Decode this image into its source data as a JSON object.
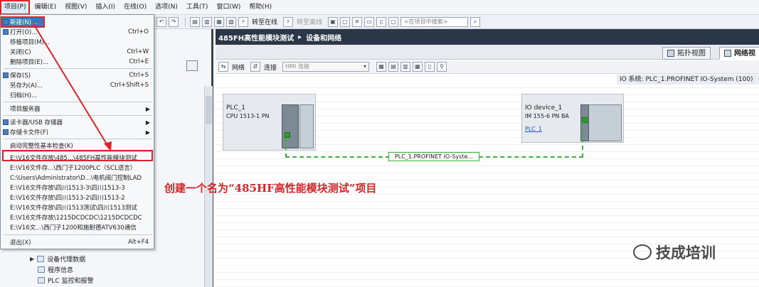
{
  "menubar": {
    "items": [
      "项目(P)",
      "编辑(E)",
      "视图(V)",
      "插入(I)",
      "在线(O)",
      "选项(N)",
      "工具(T)",
      "窗口(W)",
      "帮助(H)"
    ]
  },
  "toolbar": {
    "go_online": "转至在线",
    "go_offline": "转至离线",
    "search_placeholder": "<在项目中搜索>"
  },
  "project_menu": {
    "items": [
      {
        "label": "新建(N)...",
        "shortcut": ""
      },
      {
        "label": "打开(O)...",
        "shortcut": "Ctrl+O"
      },
      {
        "label": "移植项目(M)...",
        "shortcut": ""
      },
      {
        "label": "关闭(C)",
        "shortcut": "Ctrl+W"
      },
      {
        "label": "删除项目(E)...",
        "shortcut": "Ctrl+E"
      },
      {
        "label": "保存(S)",
        "shortcut": "Ctrl+S"
      },
      {
        "label": "另存为(A)...",
        "shortcut": "Ctrl+Shift+S"
      },
      {
        "label": "归档(H)...",
        "shortcut": ""
      },
      {
        "label": "项目服务器",
        "shortcut": ""
      },
      {
        "label": "读卡器/USB 存储器",
        "shortcut": ""
      },
      {
        "label": "存储卡文件(F)",
        "shortcut": ""
      },
      {
        "label": "启动完整性基本检查(K)",
        "shortcut": ""
      },
      {
        "label": "E:\\V16文件存放\\485...\\485FH高性能模块测试",
        "shortcut": ""
      },
      {
        "label": "E:\\V16文件存...\\西门子1200PLC（SCL语言）",
        "shortcut": ""
      },
      {
        "label": "C:\\Users\\Administrator\\D...\\电机阀门控制LAD",
        "shortcut": ""
      },
      {
        "label": "E:\\V16文件存放\\四川1513-3\\四川1513-3",
        "shortcut": ""
      },
      {
        "label": "E:\\V16文件存放\\四川1513-2\\四川1513-2",
        "shortcut": ""
      },
      {
        "label": "E:\\V16文件存放\\四川1513测试\\四川1513测试",
        "shortcut": ""
      },
      {
        "label": "E:\\V16文件存放\\1215DCDCDC\\1215DCDCDC",
        "shortcut": ""
      },
      {
        "label": "E:\\V16文...\\西门子1200和施耐德ATV630通信",
        "shortcut": ""
      },
      {
        "label": "退出(X)",
        "shortcut": "Alt+F4"
      }
    ]
  },
  "tree": {
    "items": [
      "设备代理数据",
      "程序信息",
      "PLC 监控和报警"
    ]
  },
  "editor": {
    "breadcrumb_project": "485FH高性能模块测试",
    "breadcrumb_view": "设备和网络",
    "tab_topology": "拓扑视图",
    "tab_network": "网络视",
    "btn_network": "网络",
    "btn_connection": "连接",
    "hmi_select": "HMI 连接",
    "io_system": "IO 系统: PLC_1.PROFINET IO-System (100)"
  },
  "devices": {
    "plc": {
      "name": "PLC_1",
      "type": "CPU 1513-1 PN"
    },
    "io_device": {
      "name": "IO device_1",
      "type": "IM 155-6 PN BA",
      "link": "PLC_1"
    },
    "network_label": "PLC_1.PROFINET IO-Syste..."
  },
  "annotation": "创建一个名为“485HF高性能模块测试”项目",
  "watermark": "技成培训",
  "colors": {
    "title_bar": "#2b3646",
    "highlight_red": "#d8262a",
    "network_green": "#39b33a",
    "menu_highlight": "#3b78c6"
  }
}
